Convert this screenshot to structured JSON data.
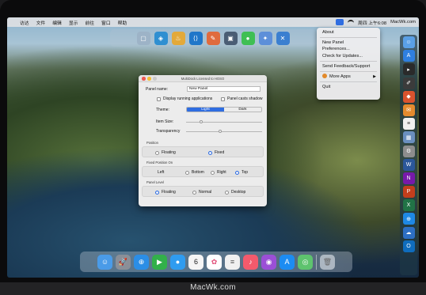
{
  "menubar": {
    "apple_glyph": "",
    "menus": [
      "访达",
      "文件",
      "编辑",
      "显示",
      "前往",
      "窗口",
      "帮助"
    ],
    "clock": "周四 上午6:08",
    "site": "MacWk.com"
  },
  "dropdown": {
    "items": [
      "About",
      "New Panel",
      "Preferences...",
      "Check for Updates...",
      "Send Feedback/Support",
      "More Apps",
      "Quit"
    ],
    "more_apps_arrow": "▶"
  },
  "prefs": {
    "title": "MultiDock  Licensed to HOSO",
    "panel_name_label": "Panel name:",
    "panel_name_value": "New Panel",
    "display_running_label": "Display running applications",
    "casts_shadow_label": "Panel casts shadow",
    "theme_label": "Theme:",
    "theme_light": "Light",
    "theme_dark": "Dark",
    "item_size_label": "Item Size:",
    "transparency_label": "Transparency",
    "item_size_level": 0.18,
    "transparency_level": 0.45,
    "position_label": "Position",
    "position_floating": "Floating",
    "position_fixed": "Fixed",
    "fixed_position_label": "Fixed Position On",
    "fixed_left": "Left",
    "fixed_bottom": "Bottom",
    "fixed_right": "Right",
    "fixed_top": "Top",
    "panel_level_label": "Panel Level",
    "level_floating": "Floating",
    "level_normal": "Normal",
    "level_desktop": "Desktop"
  },
  "top_dock_icons": [
    "window-icon",
    "swift-icon",
    "beer-icon",
    "vscode-icon",
    "brush-icon",
    "photo-icon",
    "wechat-icon",
    "app-icon",
    "tools-icon"
  ],
  "right_dock_icons": [
    "finder-icon",
    "appstore-icon",
    "terminal-icon",
    "editor-icon",
    "compressor-icon",
    "mail-icon",
    "notes-icon",
    "calendar-icon",
    "settings-icon",
    "word-icon",
    "onenote-icon",
    "powerpoint-icon",
    "excel-icon",
    "safari-icon",
    "cloud-icon",
    "outlook-icon"
  ],
  "bottom_dock": {
    "calendar_day": "6",
    "icons": [
      "finder-icon",
      "launchpad-icon",
      "safari-icon",
      "facetime-icon",
      "messages-icon",
      "calendar-icon",
      "photos-icon",
      "reminders-icon",
      "music-icon",
      "podcasts-icon",
      "appstore-icon",
      "multidock-icon",
      "trash-icon"
    ]
  },
  "watermark": "MacWk.com"
}
